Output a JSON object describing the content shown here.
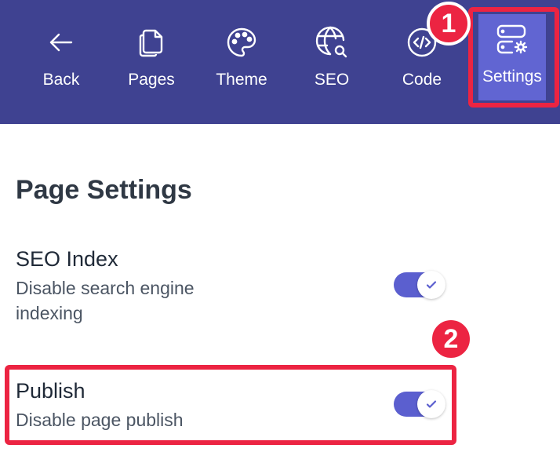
{
  "nav": {
    "items": [
      {
        "id": "back",
        "label": "Back",
        "icon": "arrow-left-icon"
      },
      {
        "id": "pages",
        "label": "Pages",
        "icon": "pages-icon"
      },
      {
        "id": "theme",
        "label": "Theme",
        "icon": "palette-icon"
      },
      {
        "id": "seo",
        "label": "SEO",
        "icon": "globe-search-icon"
      },
      {
        "id": "code",
        "label": "Code",
        "icon": "code-icon"
      },
      {
        "id": "settings",
        "label": "Settings",
        "icon": "server-gear-icon",
        "active": true
      }
    ]
  },
  "annotations": {
    "badge1": "1",
    "badge2": "2"
  },
  "page_settings": {
    "title": "Page Settings",
    "seo_index": {
      "title": "SEO Index",
      "description": "Disable search engine indexing",
      "enabled": true
    },
    "publish": {
      "title": "Publish",
      "description": "Disable page publish",
      "enabled": true
    }
  },
  "colors": {
    "topbar": "#3f4291",
    "active_tab": "#6165d2",
    "toggle_on": "#5b5fcf",
    "annotation_red": "#ec2442"
  }
}
